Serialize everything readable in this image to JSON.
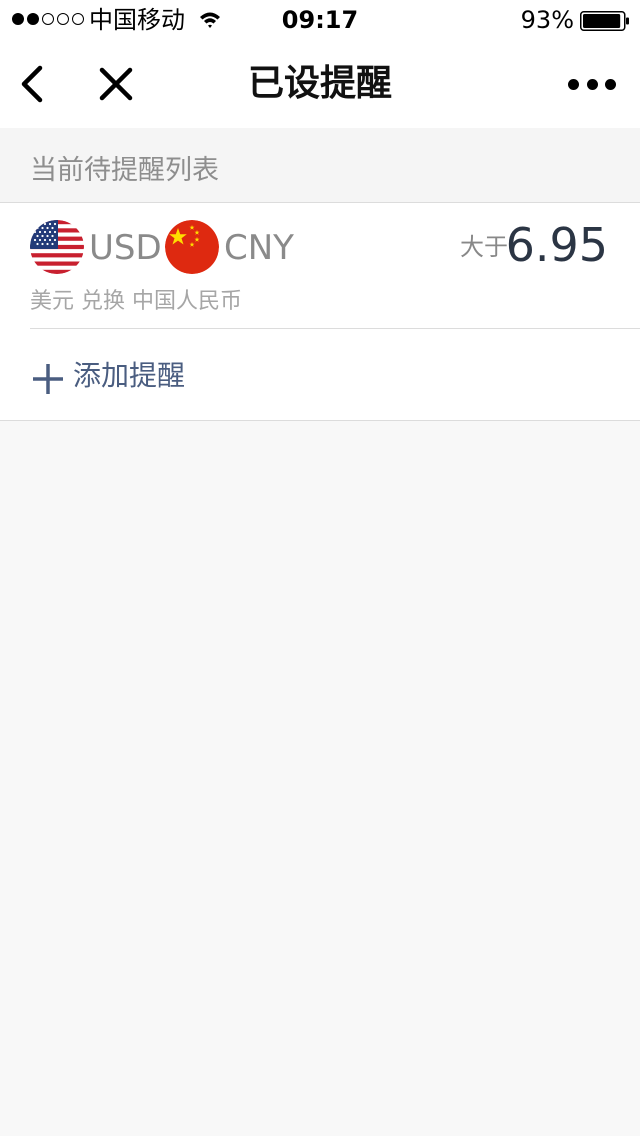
{
  "status_bar": {
    "carrier": "中国移动",
    "time": "09:17",
    "battery": "93%",
    "signal_strength": 2,
    "signal_max": 5,
    "battery_level": 0.93
  },
  "nav": {
    "title": "已设提醒",
    "back_icon": "chevron-left-icon",
    "close_icon": "close-icon",
    "more_icon": "more-dots-icon"
  },
  "section": {
    "header": "当前待提醒列表"
  },
  "alerts": [
    {
      "from_code": "USD",
      "to_code": "CNY",
      "from_flag": "us-flag-icon",
      "to_flag": "cn-flag-icon",
      "condition": "大于",
      "rate": "6.95",
      "description": "美元 兑换 中国人民币"
    }
  ],
  "add_alert": {
    "label": "添加提醒",
    "icon": "plus-icon"
  },
  "colors": {
    "background": "#f8f8f8",
    "card": "#ffffff",
    "accent": "#4a5d80",
    "rate_text": "#2b3544",
    "muted_text": "#8e8e8e"
  }
}
